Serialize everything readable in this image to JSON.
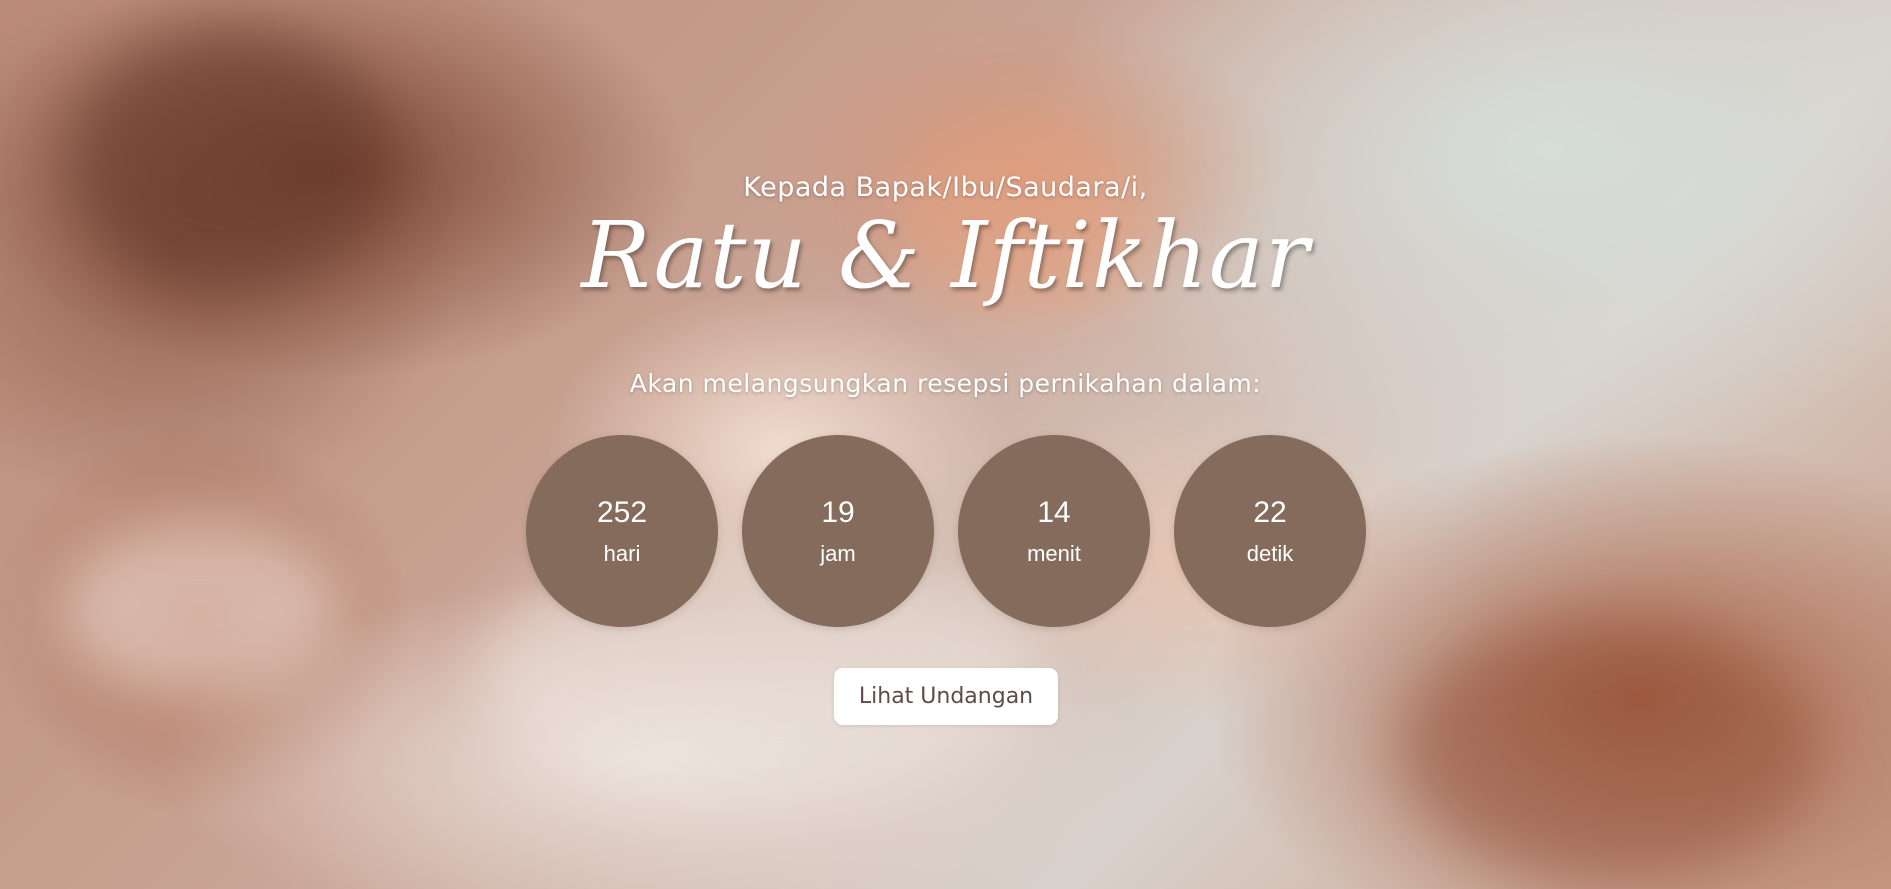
{
  "hero": {
    "greeting": "Kepada Bapak/Ibu/Saudara/i,",
    "couple_names": "Ratu & Iftikhar",
    "subtitle": "Akan melangsungkan resepsi pernikahan dalam:"
  },
  "countdown": [
    {
      "value": "252",
      "unit": "hari"
    },
    {
      "value": "19",
      "unit": "jam"
    },
    {
      "value": "14",
      "unit": "menit"
    },
    {
      "value": "22",
      "unit": "detik"
    }
  ],
  "cta": {
    "label": "Lihat Undangan"
  },
  "colors": {
    "circle_bg": "#846b5c",
    "button_text": "#5f4c44"
  }
}
